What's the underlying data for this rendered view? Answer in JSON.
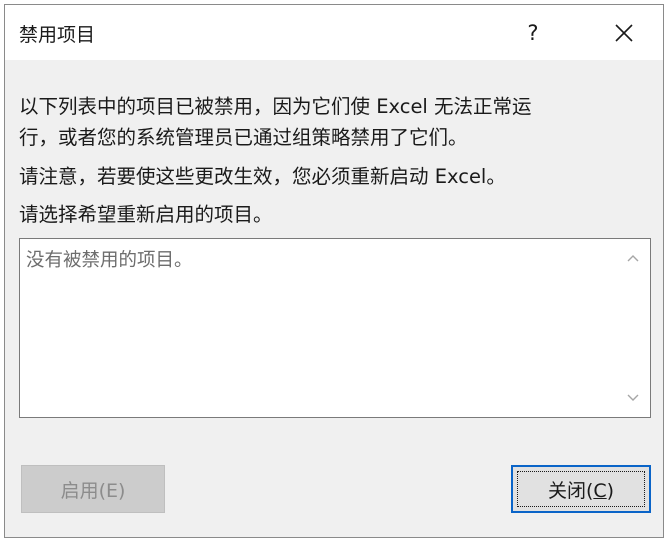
{
  "dialog": {
    "title": "禁用项目",
    "help_label": "?"
  },
  "message": {
    "line1": "以下列表中的项目已被禁用，因为它们使 Excel 无法正常运",
    "line2": "行，或者您的系统管理员已通过组策略禁用了它们。",
    "line3": "请注意，若要使这些更改生效，您必须重新启动 Excel。",
    "line4": "请选择希望重新启用的项目。"
  },
  "list": {
    "empty_text": "没有被禁用的项目。"
  },
  "buttons": {
    "enable": {
      "label": "启用(E)",
      "enabled": false
    },
    "close": {
      "label_prefix": "关闭(",
      "accel": "C",
      "label_suffix": ")"
    }
  },
  "colors": {
    "dialog_bg": "#f0f0f0",
    "title_bg": "#ffffff",
    "focus_border": "#0a64c8",
    "disabled_button_bg": "#cccccc"
  },
  "icons": {
    "close": "close-icon",
    "scroll_up": "chevron-up-icon",
    "scroll_down": "chevron-down-icon"
  }
}
